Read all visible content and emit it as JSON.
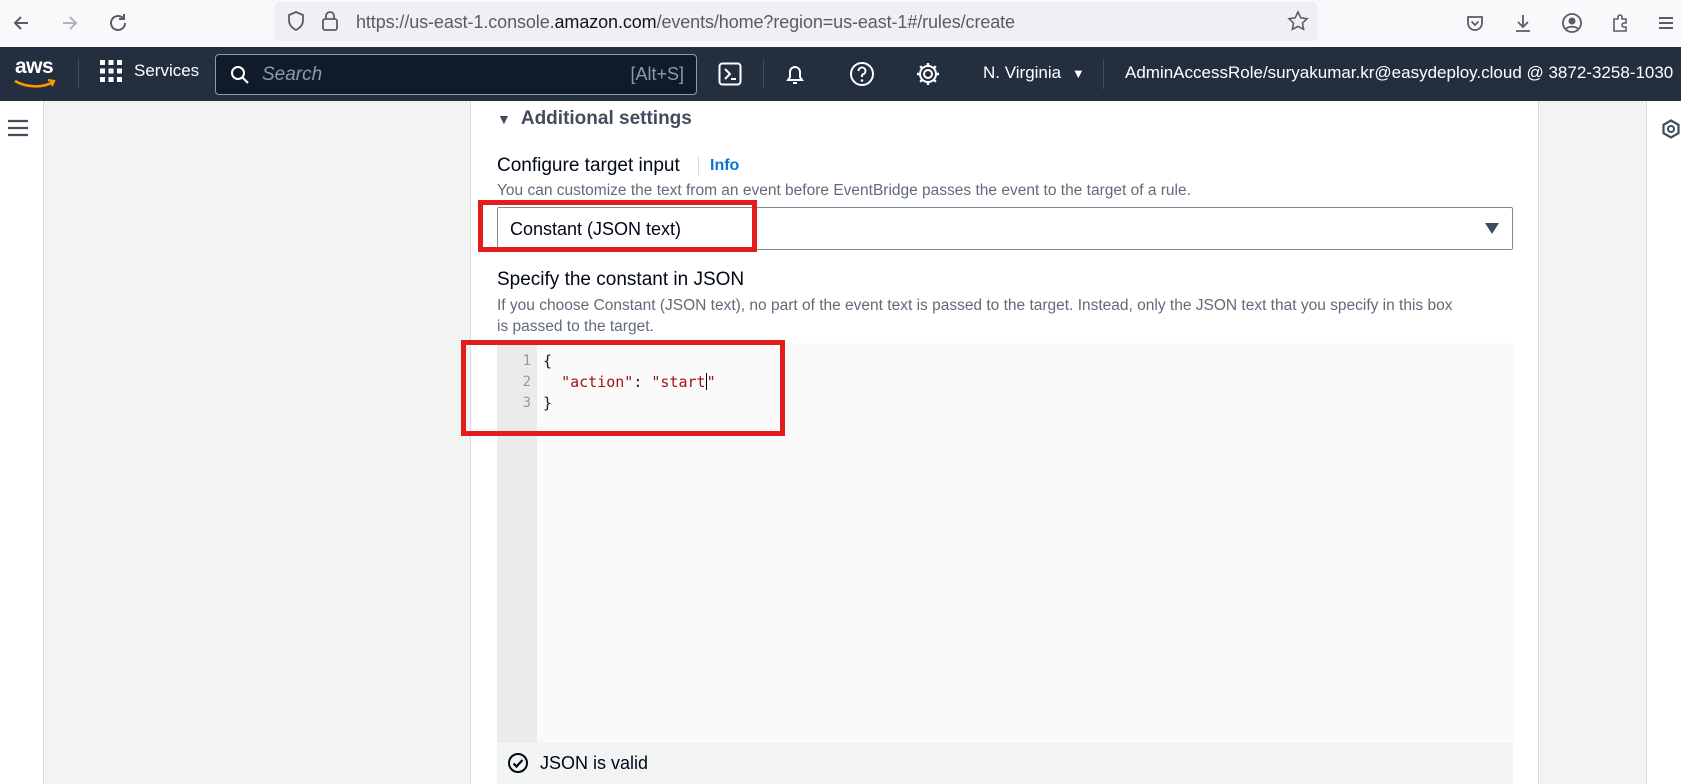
{
  "browser": {
    "url_prefix": "https://us-east-1.console.",
    "url_domain": "amazon.com",
    "url_path": "/events/home?region=us-east-1#/rules/create"
  },
  "aws_nav": {
    "logo_text": "aws",
    "services_label": "Services",
    "search_placeholder": "Search",
    "search_shortcut": "[Alt+S]",
    "region_label": "N. Virginia",
    "account_label": "AdminAccessRole/suryakumar.kr@easydeploy.cloud @ 3872-3258-1030"
  },
  "content": {
    "section_title": "Additional settings",
    "target_input_label": "Configure target input",
    "info_link": "Info",
    "target_input_desc": "You can customize the text from an event before EventBridge passes the event to the target of a rule.",
    "target_input_value": "Constant (JSON text)",
    "constant_label": "Specify the constant in JSON",
    "constant_desc_1": "If you choose Constant (JSON text), no part of the event text is passed to the target. Instead, only the JSON text that you specify in this box",
    "constant_desc_2": "is passed to the target.",
    "editor": {
      "line_numbers": [
        "1",
        "2",
        "3"
      ],
      "line1": "{",
      "line2_key": "\"action\"",
      "line2_colon": ": ",
      "line2_value": "\"start",
      "line2_end": "\"",
      "line3": "}"
    },
    "validation_status": "JSON is valid"
  },
  "colors": {
    "aws_nav_bg": "#232f3e",
    "highlight_red": "#e31c1c",
    "link_blue": "#0972d3"
  }
}
